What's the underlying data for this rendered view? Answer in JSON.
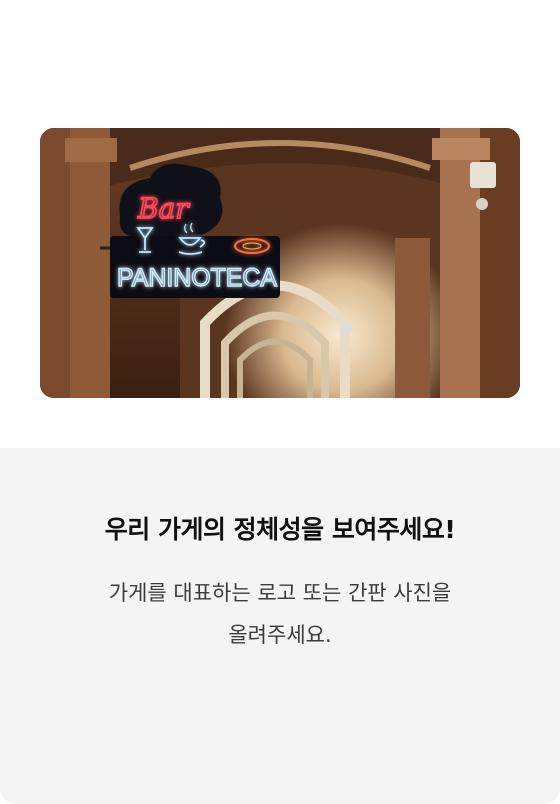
{
  "photo": {
    "sign": {
      "top_text": "Bar",
      "bottom_text": "PANINOTECA"
    },
    "icons": [
      "cocktail-glass-icon",
      "coffee-cup-icon",
      "plate-icon"
    ],
    "colors": {
      "neon_red": "#ff4a5a",
      "neon_blue": "#bfe9ff",
      "arch_wall": "#8a5a3c"
    }
  },
  "content": {
    "title": "우리 가게의 정체성을 보여주세요!",
    "desc_line1": "가게를 대표하는 로고 또는 간판 사진을",
    "desc_line2": "올려주세요."
  }
}
